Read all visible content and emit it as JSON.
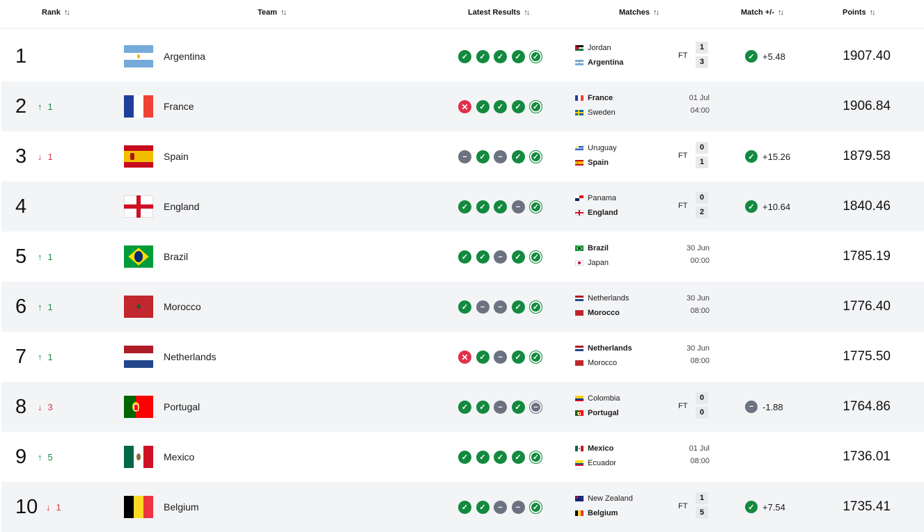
{
  "header": {
    "rank": "Rank",
    "team": "Team",
    "latest_results": "Latest Results",
    "matches": "Matches",
    "match_pm": "Match +/-",
    "points": "Points"
  },
  "colors": {
    "win": "#138a3f",
    "loss": "#e0314b",
    "draw": "#6c7280",
    "up": "#148a3c",
    "down": "#d63648"
  },
  "rows": [
    {
      "rank": "1",
      "move": "",
      "team": "Argentina",
      "flag": "argentina",
      "results": [
        "W",
        "W",
        "W",
        "W",
        "W"
      ],
      "match": {
        "home": "Jordan",
        "home_flag": "jordan",
        "away": "Argentina",
        "away_flag": "argentina",
        "bold": "away",
        "ft": "FT",
        "s1": "1",
        "s2": "3",
        "date": "",
        "time": ""
      },
      "delta": "+5.48",
      "delta_type": "W",
      "points": "1907.40"
    },
    {
      "rank": "2",
      "move": "1",
      "dir": "up",
      "team": "France",
      "flag": "france",
      "results": [
        "L",
        "W",
        "W",
        "W",
        "W"
      ],
      "match": {
        "home": "France",
        "home_flag": "france",
        "away": "Sweden",
        "away_flag": "sweden",
        "bold": "home",
        "ft": "",
        "s1": "",
        "s2": "",
        "date": "01 Jul",
        "time": "04:00"
      },
      "delta": "",
      "delta_type": "",
      "points": "1906.84"
    },
    {
      "rank": "3",
      "move": "1",
      "dir": "down",
      "team": "Spain",
      "flag": "spain",
      "results": [
        "D",
        "W",
        "D",
        "W",
        "W"
      ],
      "match": {
        "home": "Uruguay",
        "home_flag": "uruguay",
        "away": "Spain",
        "away_flag": "spain",
        "bold": "away",
        "ft": "FT",
        "s1": "0",
        "s2": "1",
        "date": "",
        "time": ""
      },
      "delta": "+15.26",
      "delta_type": "W",
      "points": "1879.58"
    },
    {
      "rank": "4",
      "move": "",
      "team": "England",
      "flag": "england",
      "results": [
        "W",
        "W",
        "W",
        "D",
        "W"
      ],
      "match": {
        "home": "Panama",
        "home_flag": "panama",
        "away": "England",
        "away_flag": "england",
        "bold": "away",
        "ft": "FT",
        "s1": "0",
        "s2": "2",
        "date": "",
        "time": ""
      },
      "delta": "+10.64",
      "delta_type": "W",
      "points": "1840.46"
    },
    {
      "rank": "5",
      "move": "1",
      "dir": "up",
      "team": "Brazil",
      "flag": "brazil",
      "results": [
        "W",
        "W",
        "D",
        "W",
        "W"
      ],
      "match": {
        "home": "Brazil",
        "home_flag": "brazil",
        "away": "Japan",
        "away_flag": "japan",
        "bold": "home",
        "ft": "",
        "s1": "",
        "s2": "",
        "date": "30 Jun",
        "time": "00:00"
      },
      "delta": "",
      "delta_type": "",
      "points": "1785.19"
    },
    {
      "rank": "6",
      "move": "1",
      "dir": "up",
      "team": "Morocco",
      "flag": "morocco",
      "results": [
        "W",
        "D",
        "D",
        "W",
        "W"
      ],
      "match": {
        "home": "Netherlands",
        "home_flag": "netherlands",
        "away": "Morocco",
        "away_flag": "morocco",
        "bold": "away",
        "ft": "",
        "s1": "",
        "s2": "",
        "date": "30 Jun",
        "time": "08:00"
      },
      "delta": "",
      "delta_type": "",
      "points": "1776.40"
    },
    {
      "rank": "7",
      "move": "1",
      "dir": "up",
      "team": "Netherlands",
      "flag": "netherlands",
      "results": [
        "L",
        "W",
        "D",
        "W",
        "W"
      ],
      "match": {
        "home": "Netherlands",
        "home_flag": "netherlands",
        "away": "Morocco",
        "away_flag": "morocco",
        "bold": "home",
        "ft": "",
        "s1": "",
        "s2": "",
        "date": "30 Jun",
        "time": "08:00"
      },
      "delta": "",
      "delta_type": "",
      "points": "1775.50"
    },
    {
      "rank": "8",
      "move": "3",
      "dir": "down",
      "team": "Portugal",
      "flag": "portugal",
      "results": [
        "W",
        "W",
        "D",
        "W",
        "D"
      ],
      "match": {
        "home": "Colombia",
        "home_flag": "colombia",
        "away": "Portugal",
        "away_flag": "portugal",
        "bold": "away",
        "ft": "FT",
        "s1": "0",
        "s2": "0",
        "date": "",
        "time": ""
      },
      "delta": "-1.88",
      "delta_type": "D",
      "points": "1764.86"
    },
    {
      "rank": "9",
      "move": "5",
      "dir": "up",
      "team": "Mexico",
      "flag": "mexico",
      "results": [
        "W",
        "W",
        "W",
        "W",
        "W"
      ],
      "match": {
        "home": "Mexico",
        "home_flag": "mexico",
        "away": "Ecuador",
        "away_flag": "ecuador",
        "bold": "home",
        "ft": "",
        "s1": "",
        "s2": "",
        "date": "01 Jul",
        "time": "08:00"
      },
      "delta": "",
      "delta_type": "",
      "points": "1736.01"
    },
    {
      "rank": "10",
      "move": "1",
      "dir": "down",
      "team": "Belgium",
      "flag": "belgium",
      "results": [
        "W",
        "W",
        "D",
        "D",
        "W"
      ],
      "match": {
        "home": "New Zealand",
        "home_flag": "newzealand",
        "away": "Belgium",
        "away_flag": "belgium",
        "bold": "away",
        "ft": "FT",
        "s1": "1",
        "s2": "5",
        "date": "",
        "time": ""
      },
      "delta": "+7.54",
      "delta_type": "W",
      "points": "1735.41"
    }
  ]
}
